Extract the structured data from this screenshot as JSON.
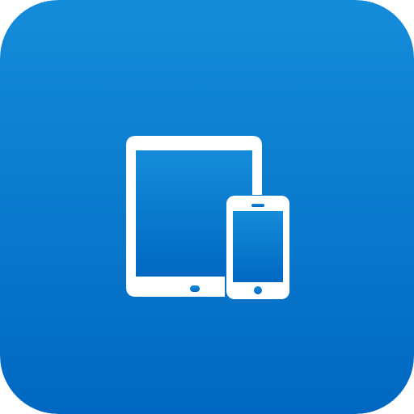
{
  "app_icon": {
    "name": "tablet-and-phone-app-icon",
    "icon": "tablet-and-phone-icon",
    "colors": {
      "gradient_top": "#158CD9",
      "gradient_bottom": "#0068C2",
      "glyph": "#FFFFFF"
    }
  }
}
